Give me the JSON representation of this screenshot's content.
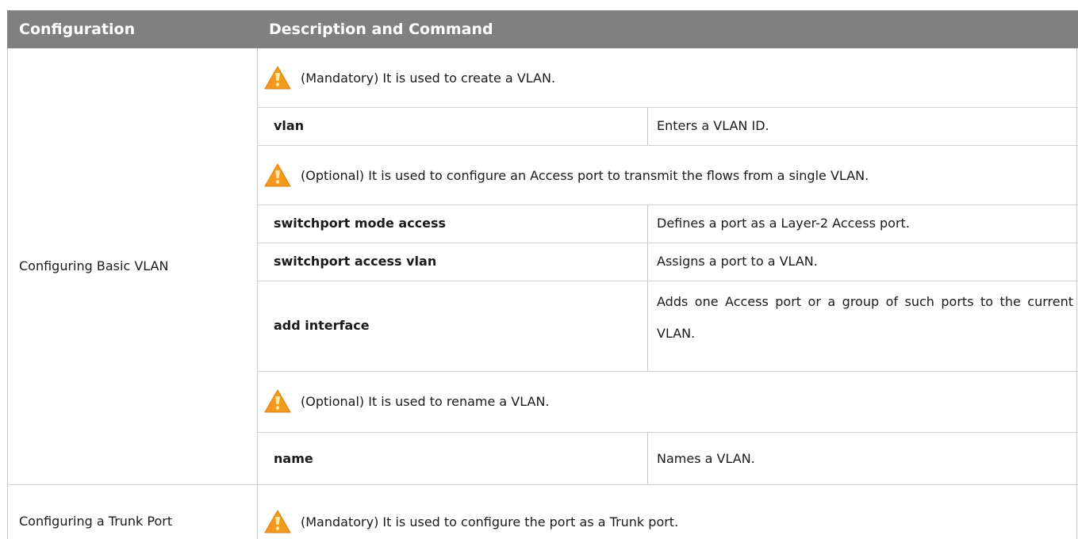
{
  "table": {
    "headers": {
      "configuration": "Configuration",
      "description": "Description and Command"
    },
    "rows": [
      {
        "configuration": "Configuring Basic VLAN",
        "notes": [
          {
            "text": "(Mandatory) It is used to create a VLAN."
          },
          {
            "text": "(Optional) It is used to configure an Access port to transmit the flows from a single VLAN."
          },
          {
            "text": "(Optional) It is used to rename a VLAN."
          }
        ],
        "commands": [
          {
            "command": "vlan",
            "description": "Enters a VLAN ID."
          },
          {
            "command": "switchport mode access",
            "description": "Defines a port as a Layer-2 Access port."
          },
          {
            "command": "switchport access vlan",
            "description": "Assigns a port to a VLAN."
          },
          {
            "command": "add interface",
            "description": "Adds one Access port or a group of such ports to the current VLAN."
          },
          {
            "command": "name",
            "description": "Names a VLAN."
          }
        ]
      },
      {
        "configuration": "Configuring a Trunk Port",
        "notes": [
          {
            "text": "(Mandatory) It is used to configure the port as a Trunk port."
          }
        ]
      }
    ]
  },
  "icons": {
    "warning": "warning-triangle-icon"
  },
  "colors": {
    "header_bg": "#808080",
    "header_text": "#ffffff",
    "warning_orange": "#f39a1e"
  }
}
